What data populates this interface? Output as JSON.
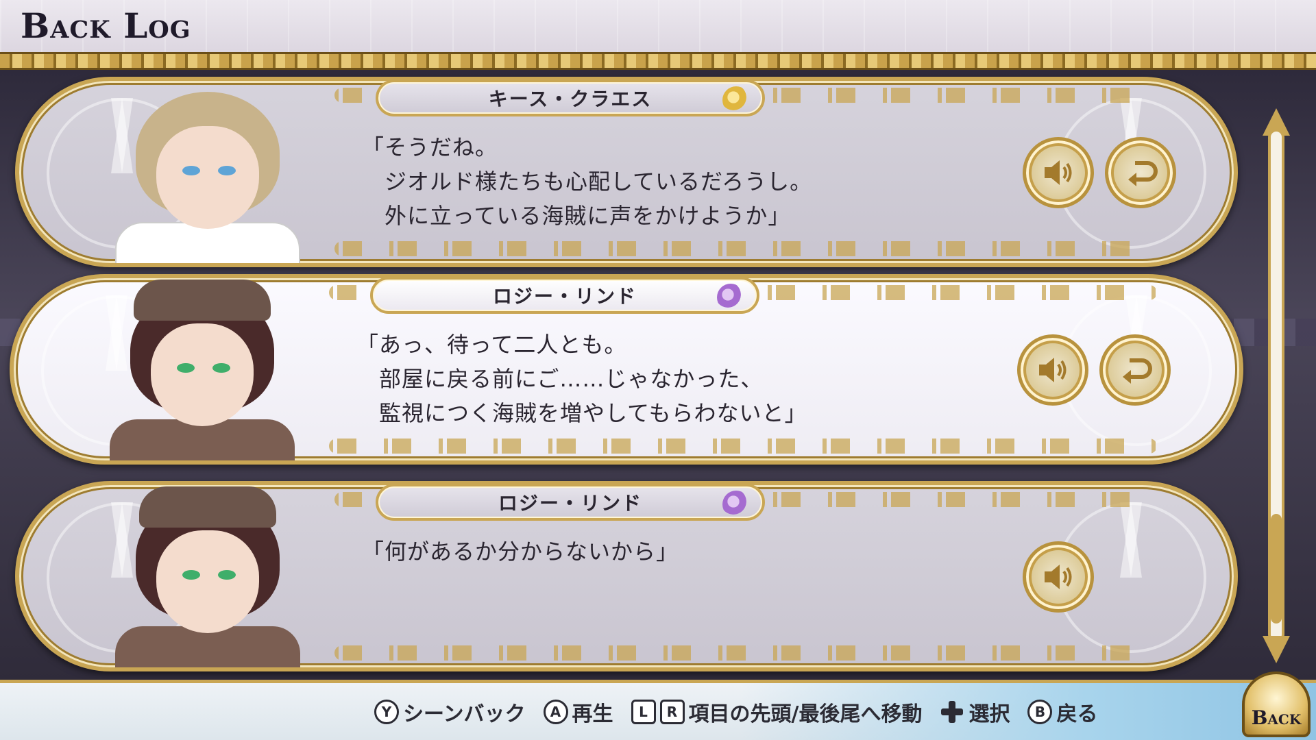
{
  "header": {
    "title": "Back Log"
  },
  "entries": [
    {
      "name": "キース・クラエス",
      "rose": "gold",
      "lines": [
        "「そうだね。",
        "　ジオルド様たちも心配しているだろうし。",
        "　外に立っている海賊に声をかけようか」"
      ],
      "has_return": true,
      "portrait": "blond-young-man"
    },
    {
      "name": "ロジー・リンド",
      "rose": "purple",
      "lines": [
        "「あっ、待って二人とも。",
        "　部屋に戻る前にご……じゃなかった、",
        "　監視につく海賊を増やしてもらわないと」"
      ],
      "has_return": true,
      "portrait": "brown-haired-man-with-hat",
      "selected": true
    },
    {
      "name": "ロジー・リンド",
      "rose": "purple",
      "lines": [
        "「何があるか分からないから」"
      ],
      "has_return": false,
      "portrait": "brown-haired-man-with-hat"
    }
  ],
  "footer": {
    "hints": [
      {
        "buttons": [
          "Y"
        ],
        "label": "シーンバック"
      },
      {
        "buttons": [
          "A"
        ],
        "label": "再生"
      },
      {
        "buttons": [
          "L",
          "R"
        ],
        "label": "項目の先頭/最後尾へ移動"
      },
      {
        "buttons": [
          "dpad"
        ],
        "label": "選択"
      },
      {
        "buttons": [
          "B"
        ],
        "label": "戻る"
      }
    ],
    "back_label": "Back"
  },
  "colors": {
    "gold": "#c9a654",
    "panel": "#d6d3dc",
    "selected_panel": "#fbfaff",
    "footer_blue": "#a8d4ec"
  },
  "icons": {
    "voice": "speaker-icon",
    "return": "return-arrow-icon"
  }
}
